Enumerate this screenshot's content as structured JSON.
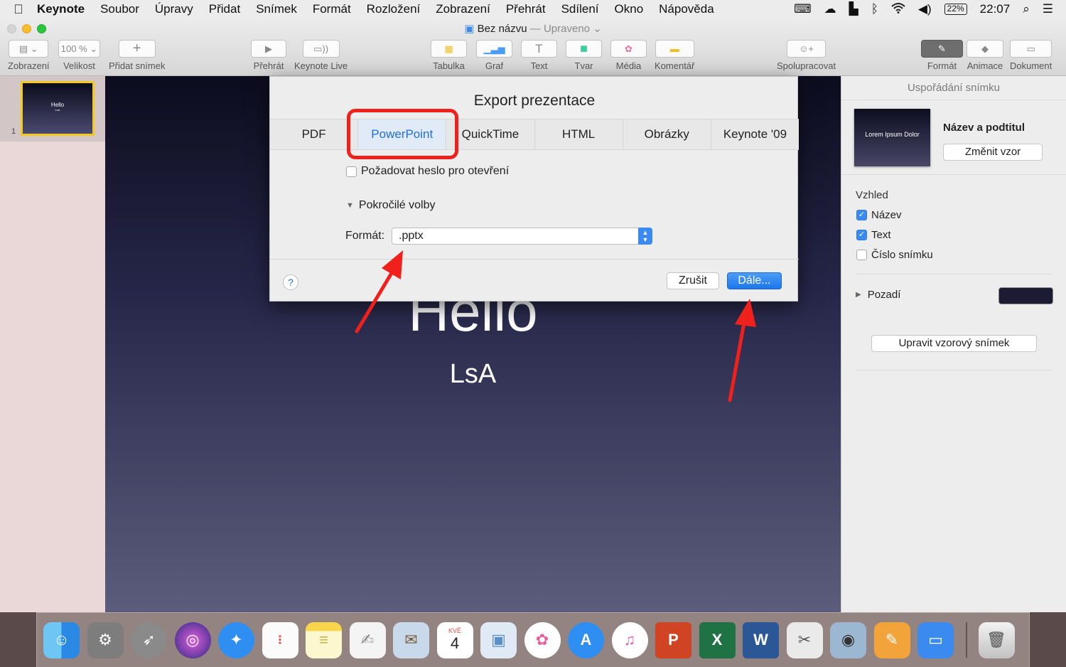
{
  "menubar": {
    "apple": "",
    "app": "Keynote",
    "items": [
      "Soubor",
      "Úpravy",
      "Přidat",
      "Snímek",
      "Formát",
      "Rozložení",
      "Zobrazení",
      "Přehrát",
      "Sdílení",
      "Okno",
      "Nápověda"
    ],
    "battery": "22%",
    "clock": "22:07"
  },
  "window": {
    "title": "Bez názvu",
    "status": "— Upraveno"
  },
  "toolbar": {
    "view": "Zobrazení",
    "zoom_value": "100 %",
    "zoom": "Velikost",
    "add_slide": "Přidat snímek",
    "play": "Přehrát",
    "live": "Keynote Live",
    "table": "Tabulka",
    "chart": "Graf",
    "text": "Text",
    "shape": "Tvar",
    "media": "Média",
    "comment": "Komentář",
    "collaborate": "Spolupracovat",
    "format": "Formát",
    "animate": "Animace",
    "document": "Dokument"
  },
  "navigator": {
    "slide_number": "1",
    "thumb_title": "Hello",
    "thumb_sub": "LsA"
  },
  "slide": {
    "title": "Hello",
    "subtitle": "LsA"
  },
  "dialog": {
    "title": "Export prezentace",
    "tabs": [
      "PDF",
      "PowerPoint",
      "QuickTime",
      "HTML",
      "Obrázky",
      "Keynote '09"
    ],
    "active_tab": "PowerPoint",
    "password_label": "Požadovat heslo pro otevření",
    "advanced": "Pokročilé volby",
    "format_label": "Formát:",
    "format_value": ".pptx",
    "help": "?",
    "cancel": "Zrušit",
    "next": "Dále..."
  },
  "inspector": {
    "header": "Uspořádání snímku",
    "layout_thumb": "Lorem Ipsum Dolor",
    "layout_name": "Název a podtitul",
    "change_master": "Změnit vzor",
    "appearance": "Vzhled",
    "opt_title": "Název",
    "opt_text": "Text",
    "opt_number": "Číslo snímku",
    "background": "Pozadí",
    "edit_master": "Upravit vzorový snímek",
    "background_color": "#1b1b34"
  },
  "annotation": {
    "color": "#f0201c"
  },
  "dock": {
    "apps": [
      "finder-icon",
      "system-preferences-icon",
      "launchpad-icon",
      "siri-icon",
      "safari-icon",
      "reminders-icon",
      "notes-icon",
      "textedit-icon",
      "mail-icon",
      "calendar-icon",
      "preview-icon",
      "photos-icon",
      "app-store-icon",
      "itunes-icon",
      "powerpoint-icon",
      "excel-icon",
      "word-icon",
      "scissors-icon",
      "image-capture-icon",
      "pages-icon",
      "keynote-icon",
      "trash-icon"
    ],
    "calendar_month": "KVĚ",
    "calendar_day": "4"
  }
}
